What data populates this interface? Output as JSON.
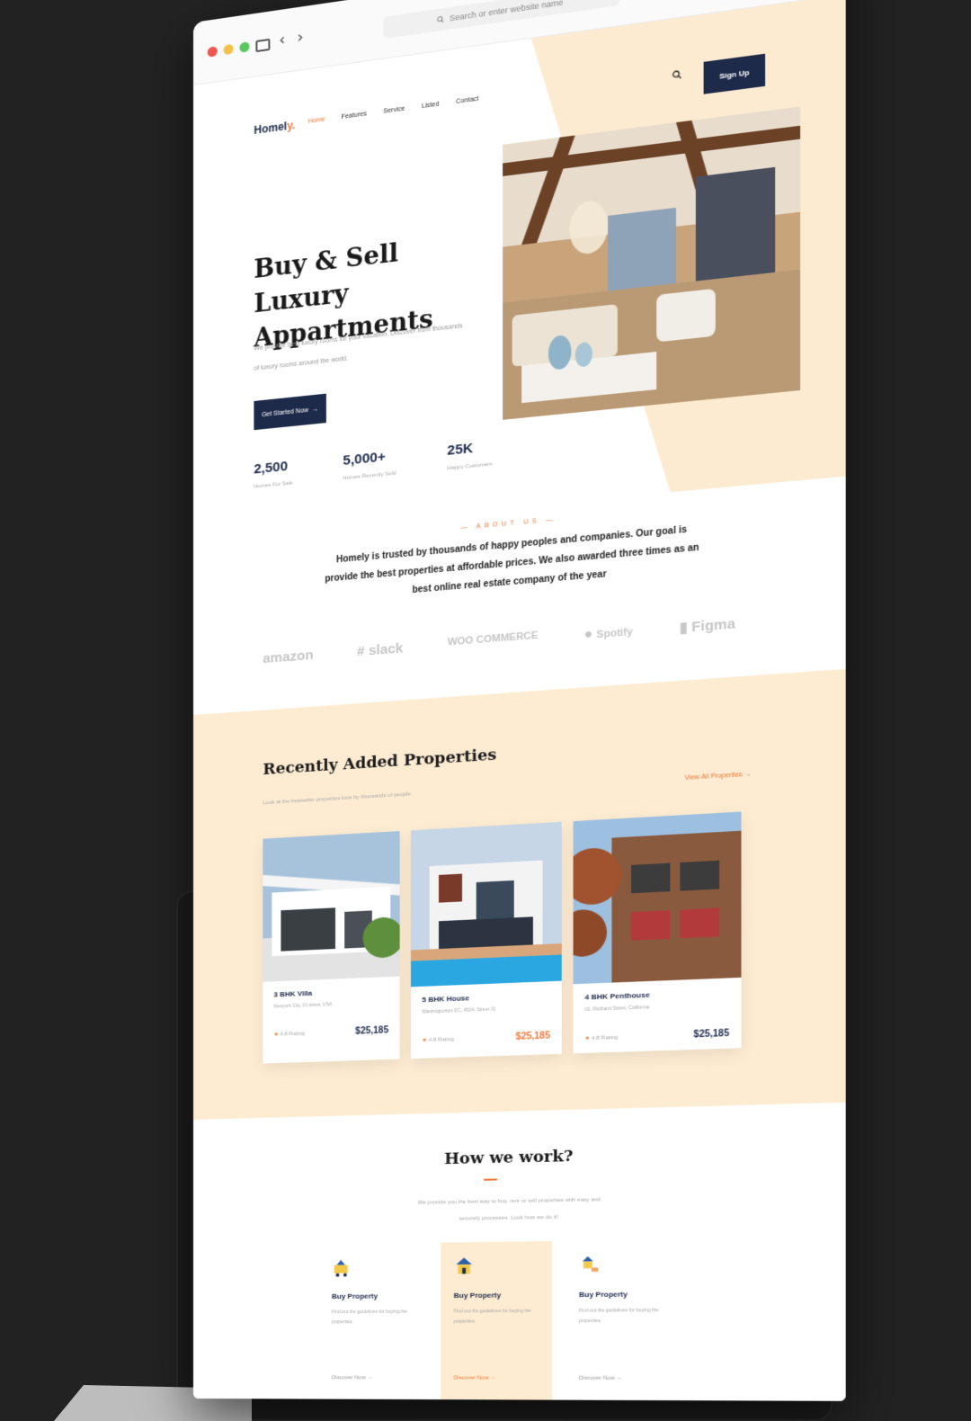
{
  "browser": {
    "url_placeholder": "Search or enter website name"
  },
  "nav": {
    "logo_main": "Homel",
    "logo_accent": "y.",
    "links": [
      "Home",
      "Features",
      "Service",
      "Listed",
      "Contact"
    ],
    "signup": "Sign Up"
  },
  "hero": {
    "title": "Buy & Sell Luxury Appartments",
    "description": "We provide best luxury rooms for your vacation. Discover from thousands of luxury rooms around the world.",
    "cta": "Get Started Now"
  },
  "stats": [
    {
      "value": "2,500",
      "label": "Homes For Sale"
    },
    {
      "value": "5,000+",
      "label": "Homes Recently Sold"
    },
    {
      "value": "25K",
      "label": "Happy Customers"
    }
  ],
  "about": {
    "eyebrow": "ABOUT US",
    "text": "Homely is trusted by thousands of happy peoples and companies. Our goal is provide the best properties at affordable prices. We also awarded three times as an best online real estate company of the year"
  },
  "partners": [
    "amazon",
    "slack",
    "WOO COMMERCE",
    "Spotify",
    "Figma"
  ],
  "properties": {
    "title": "Recently Added  Properties",
    "subtitle": "Look at the bestseller properties love by thousands of people.",
    "view_all": "View All Properties",
    "items": [
      {
        "name": "3 BHK Villa",
        "address": "Newyork City, 01 street, USA",
        "rating": "4.8 Rating",
        "price": "$25,185"
      },
      {
        "name": "5 BHK House",
        "address": "Washingtonton DC, 4524, Street 31",
        "rating": "4.8 Rating",
        "price": "$25,185"
      },
      {
        "name": "4 BHK Penthouse",
        "address": "03, Richland Street, California",
        "rating": "4.8 Rating",
        "price": "$25,185"
      }
    ]
  },
  "how": {
    "title": "How we work?",
    "description": "We provide you the best way to buy, renr or sell properties with easy and securely processes. Look how we do it!",
    "steps": [
      {
        "title": "Buy Property",
        "desc": "Find out the guidelines for buying the properties.",
        "link": "Discover Now"
      },
      {
        "title": "Buy Property",
        "desc": "Find out the guidelines for buying the properties.",
        "link": "Discover Now"
      },
      {
        "title": "Buy Property",
        "desc": "Find out the guidelines for buying the properties.",
        "link": "Discover Now"
      }
    ]
  },
  "colors": {
    "accent": "#f07a3a",
    "navy": "#1e2a4a",
    "cream": "#fdecd2"
  }
}
